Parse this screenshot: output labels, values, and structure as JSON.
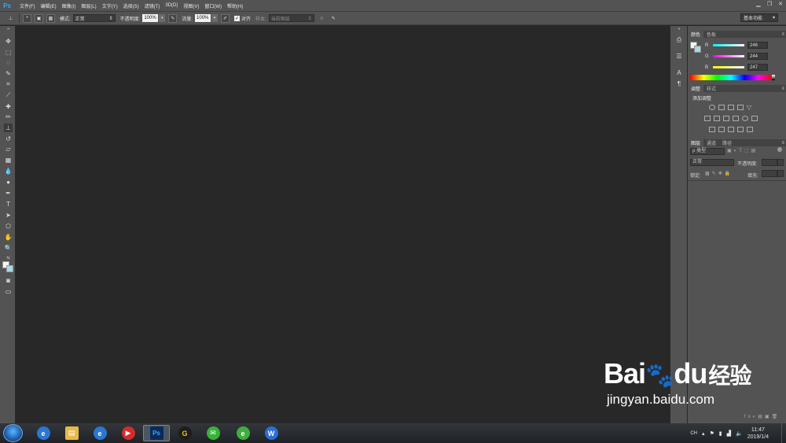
{
  "app": {
    "logo": "Ps"
  },
  "menu": [
    "文件(F)",
    "编辑(E)",
    "图像(I)",
    "图层(L)",
    "文字(Y)",
    "选择(S)",
    "滤镜(T)",
    "3D(D)",
    "视图(V)",
    "窗口(W)",
    "帮助(H)"
  ],
  "window_controls": {
    "minimize": "▁",
    "restore": "❐",
    "close": "✕"
  },
  "options": {
    "mode_label": "模式:",
    "mode_value": "正常",
    "opacity_label": "不透明度:",
    "opacity_value": "100%",
    "flow_label": "流量:",
    "flow_value": "100%",
    "aligned_label": "对齐",
    "sample_label": "样本:",
    "sample_value": "当前图层",
    "workspace_value": "基本功能"
  },
  "color_panel": {
    "tabs": [
      "颜色",
      "色板"
    ],
    "channels": [
      {
        "name": "R",
        "value": "246",
        "color": "#e24b4b"
      },
      {
        "name": "G",
        "value": "244",
        "color": "#4bd04b"
      },
      {
        "name": "B",
        "value": "247",
        "color": "#4b6fe2"
      }
    ]
  },
  "adjust_panel": {
    "tabs": [
      "调整",
      "样式"
    ],
    "title": "添加调整"
  },
  "layers_panel": {
    "tabs": [
      "图层",
      "通道",
      "路径"
    ],
    "filter_value": "ρ 类型",
    "blend_value": "正常",
    "opacity_label": "不透明度:",
    "lock_label": "锁定:",
    "fill_label": "填充:"
  },
  "taskbar": {
    "apps": [
      {
        "name": "ie",
        "glyph": "e",
        "color": "#2a77d4"
      },
      {
        "name": "explorer",
        "glyph": "▤",
        "color": "#e8b94a"
      },
      {
        "name": "ie2",
        "glyph": "e",
        "color": "#2a77d4"
      },
      {
        "name": "media",
        "glyph": "▶",
        "color": "#d62b2b"
      },
      {
        "name": "photoshop",
        "glyph": "Ps",
        "color": "#0b2a5b"
      },
      {
        "name": "g-app",
        "glyph": "G",
        "color": "#1d1d1d"
      },
      {
        "name": "wechat",
        "glyph": "✉",
        "color": "#36b336"
      },
      {
        "name": "browser",
        "glyph": "e",
        "color": "#3fae3f"
      },
      {
        "name": "wps",
        "glyph": "W",
        "color": "#2b6fd6"
      }
    ],
    "ime": "CH",
    "time": "11:47",
    "date": "2019/1/4"
  },
  "watermark": {
    "brand": "Bai",
    "brand2": "du",
    "cn": "经验",
    "url": "jingyan.baidu.com"
  }
}
